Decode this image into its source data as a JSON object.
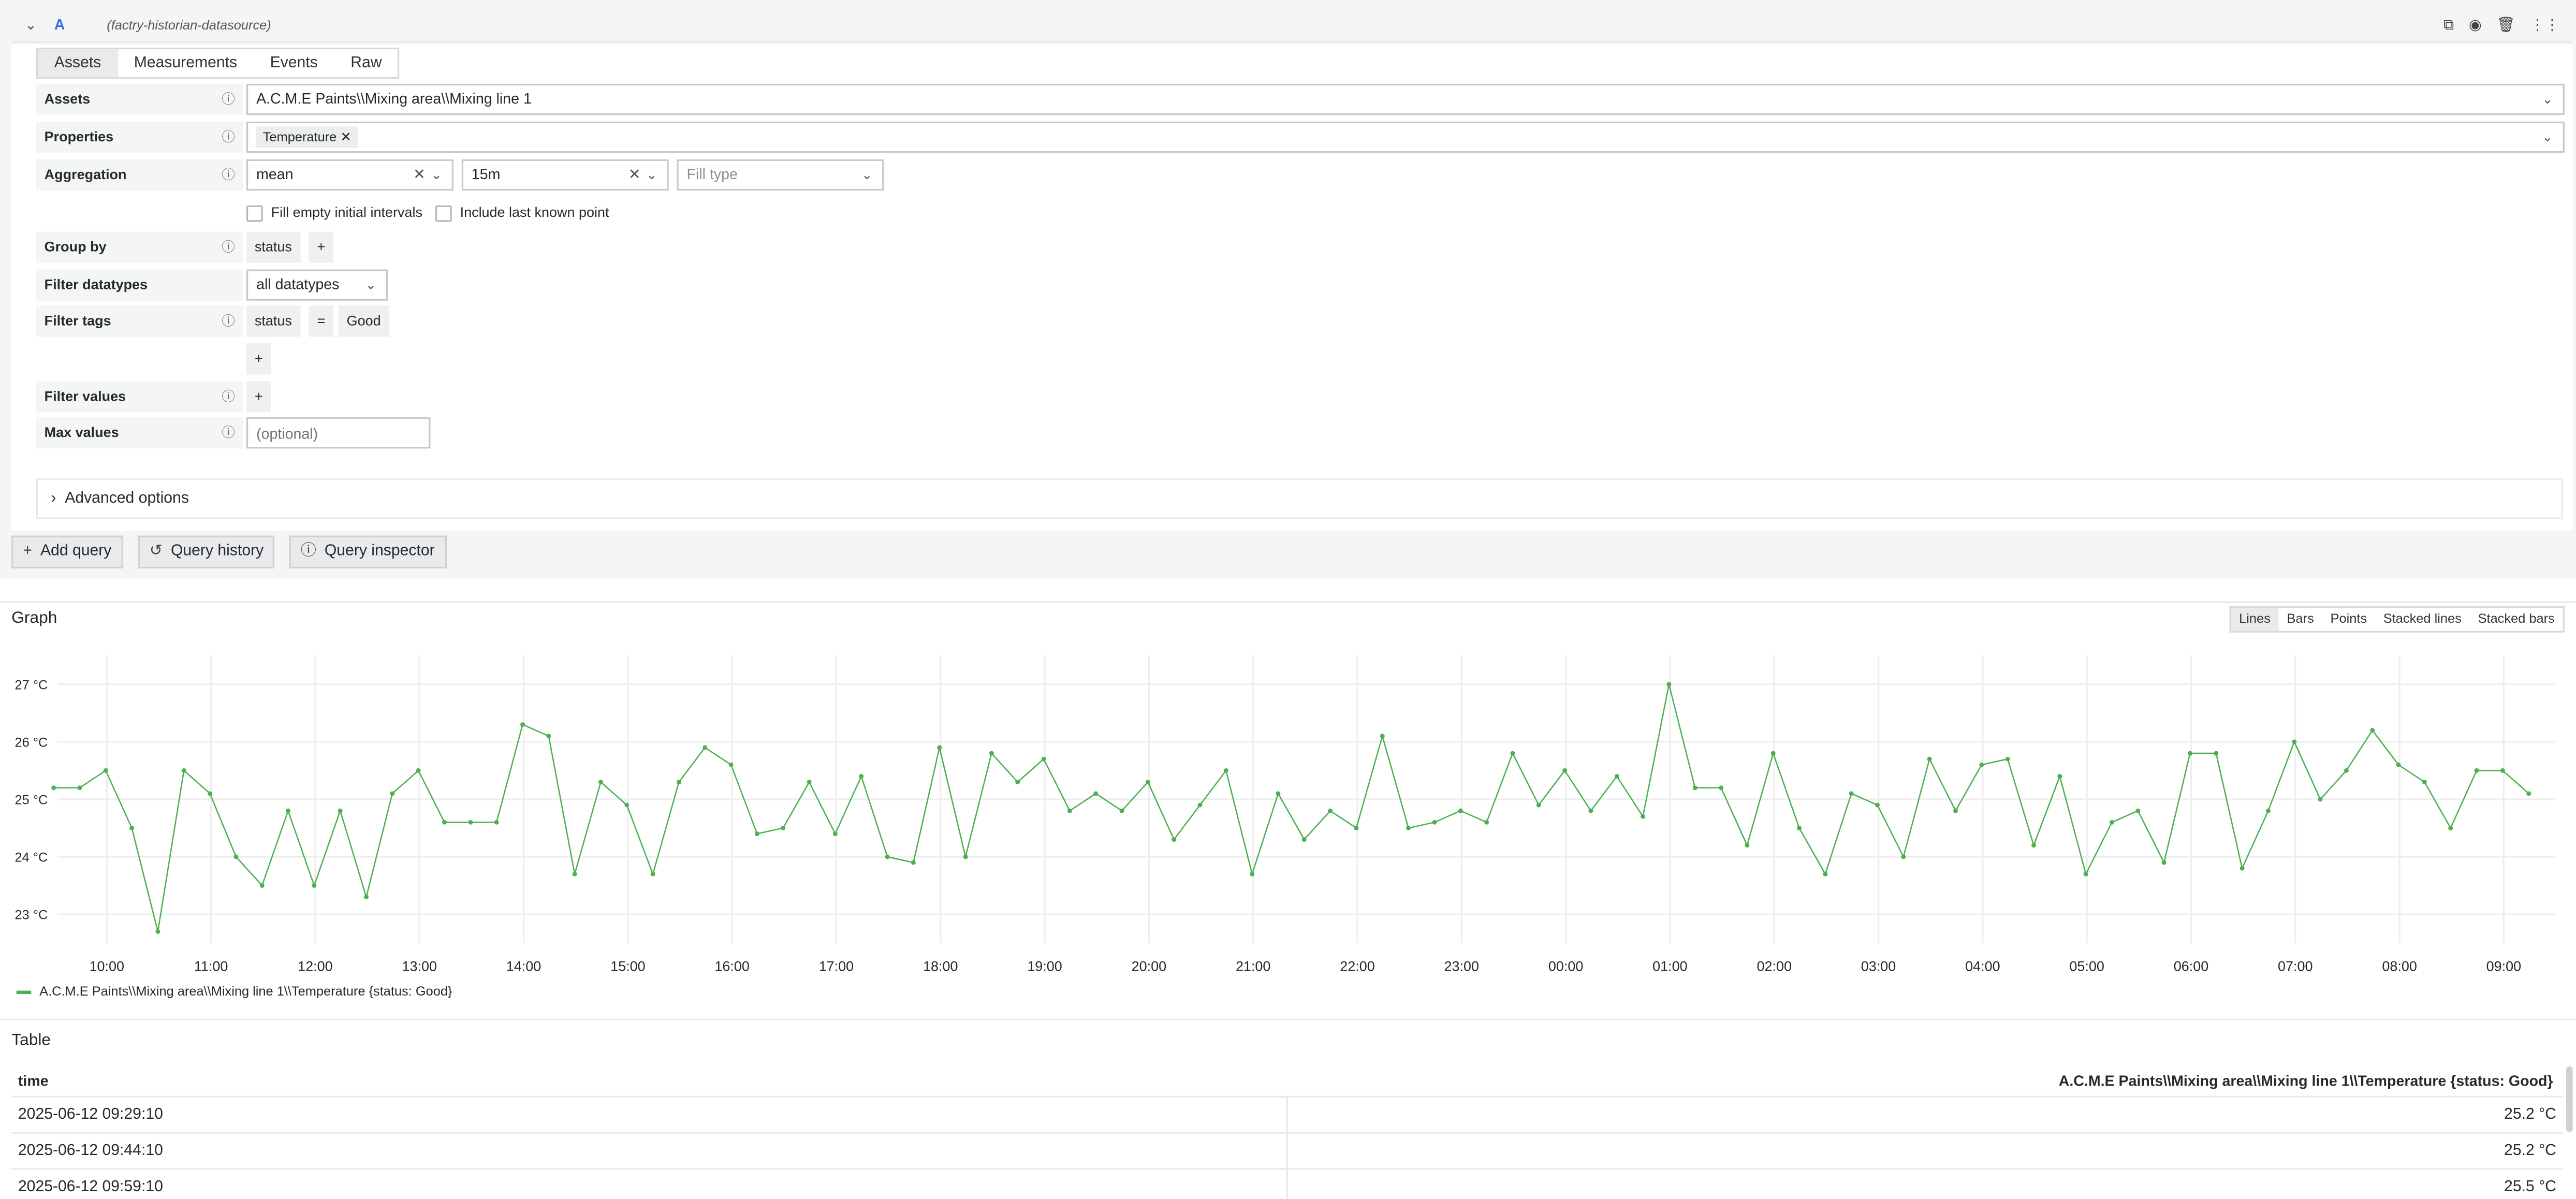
{
  "query": {
    "letter": "A",
    "datasource": "(factry-historian-datasource)",
    "tabs": [
      "Assets",
      "Measurements",
      "Events",
      "Raw"
    ],
    "assets": {
      "label": "Assets",
      "value": "A.C.M.E Paints\\\\Mixing area\\\\Mixing line 1"
    },
    "properties": {
      "label": "Properties",
      "tag": "Temperature"
    },
    "aggregation": {
      "label": "Aggregation",
      "function": "mean",
      "period": "15m",
      "fill_placeholder": "Fill type"
    },
    "options": {
      "fill_empty": "Fill empty initial intervals",
      "include_last": "Include last known point"
    },
    "group_by": {
      "label": "Group by",
      "value": "status",
      "add": "+"
    },
    "filter_datatypes": {
      "label": "Filter datatypes",
      "value": "all datatypes"
    },
    "filter_tags": {
      "label": "Filter tags",
      "key": "status",
      "op": "=",
      "value": "Good",
      "add": "+"
    },
    "filter_values": {
      "label": "Filter values",
      "add": "+"
    },
    "max_values": {
      "label": "Max values",
      "placeholder": "(optional)"
    },
    "advanced": "Advanced options"
  },
  "buttons": {
    "add_query": "Add query",
    "query_history": "Query history",
    "query_inspector": "Query inspector"
  },
  "graph": {
    "title": "Graph",
    "types": [
      "Lines",
      "Bars",
      "Points",
      "Stacked lines",
      "Stacked bars"
    ],
    "legend": "A.C.M.E Paints\\\\Mixing area\\\\Mixing line 1\\\\Temperature {status: Good}",
    "line_color": "#4caf50"
  },
  "chart_data": {
    "type": "line",
    "ylim": [
      22.5,
      27.5
    ],
    "yticks": [
      "23 °C",
      "24 °C",
      "25 °C",
      "26 °C",
      "27 °C"
    ],
    "ytick_values": [
      23,
      24,
      25,
      26,
      27
    ],
    "xticks": [
      "10:00",
      "11:00",
      "12:00",
      "13:00",
      "14:00",
      "15:00",
      "16:00",
      "17:00",
      "18:00",
      "19:00",
      "20:00",
      "21:00",
      "22:00",
      "23:00",
      "00:00",
      "01:00",
      "02:00",
      "03:00",
      "04:00",
      "05:00",
      "06:00",
      "07:00",
      "08:00",
      "09:00"
    ],
    "x_start_hours": 9.49,
    "step_hours": 0.25,
    "series": [
      {
        "name": "A.C.M.E Paints\\\\Mixing area\\\\Mixing line 1\\\\Temperature {status: Good}",
        "values": [
          25.2,
          25.2,
          25.5,
          24.5,
          22.7,
          25.5,
          25.1,
          24.0,
          23.5,
          24.8,
          23.5,
          24.8,
          23.3,
          25.1,
          25.5,
          24.6,
          24.6,
          24.6,
          26.3,
          26.1,
          23.7,
          25.3,
          24.9,
          23.7,
          25.3,
          25.9,
          25.6,
          24.4,
          24.5,
          25.3,
          24.4,
          25.4,
          24.0,
          23.9,
          25.9,
          24.0,
          25.8,
          25.3,
          25.7,
          24.8,
          25.1,
          24.8,
          25.3,
          24.3,
          24.9,
          25.5,
          23.7,
          25.1,
          24.3,
          24.8,
          24.5,
          26.1,
          24.5,
          24.6,
          24.8,
          24.6,
          25.8,
          24.9,
          25.5,
          24.8,
          25.4,
          24.7,
          27.0,
          25.2,
          25.2,
          24.2,
          25.8,
          24.5,
          23.7,
          25.1,
          24.9,
          24.0,
          25.7,
          24.8,
          25.6,
          25.7,
          24.2,
          25.4,
          23.7,
          24.6,
          24.8,
          23.9,
          25.8,
          25.8,
          23.8,
          24.8,
          26.0,
          25.0,
          25.5,
          26.2,
          25.6,
          25.3,
          24.5,
          25.5,
          25.5,
          25.1
        ]
      }
    ]
  },
  "table": {
    "title": "Table",
    "columns": [
      "time",
      "A.C.M.E Paints\\\\Mixing area\\\\Mixing line 1\\\\Temperature {status: Good}"
    ],
    "rows": [
      [
        "2025-06-12 09:29:10",
        "25.2 °C"
      ],
      [
        "2025-06-12 09:44:10",
        "25.2 °C"
      ],
      [
        "2025-06-12 09:59:10",
        "25.5 °C"
      ]
    ]
  }
}
